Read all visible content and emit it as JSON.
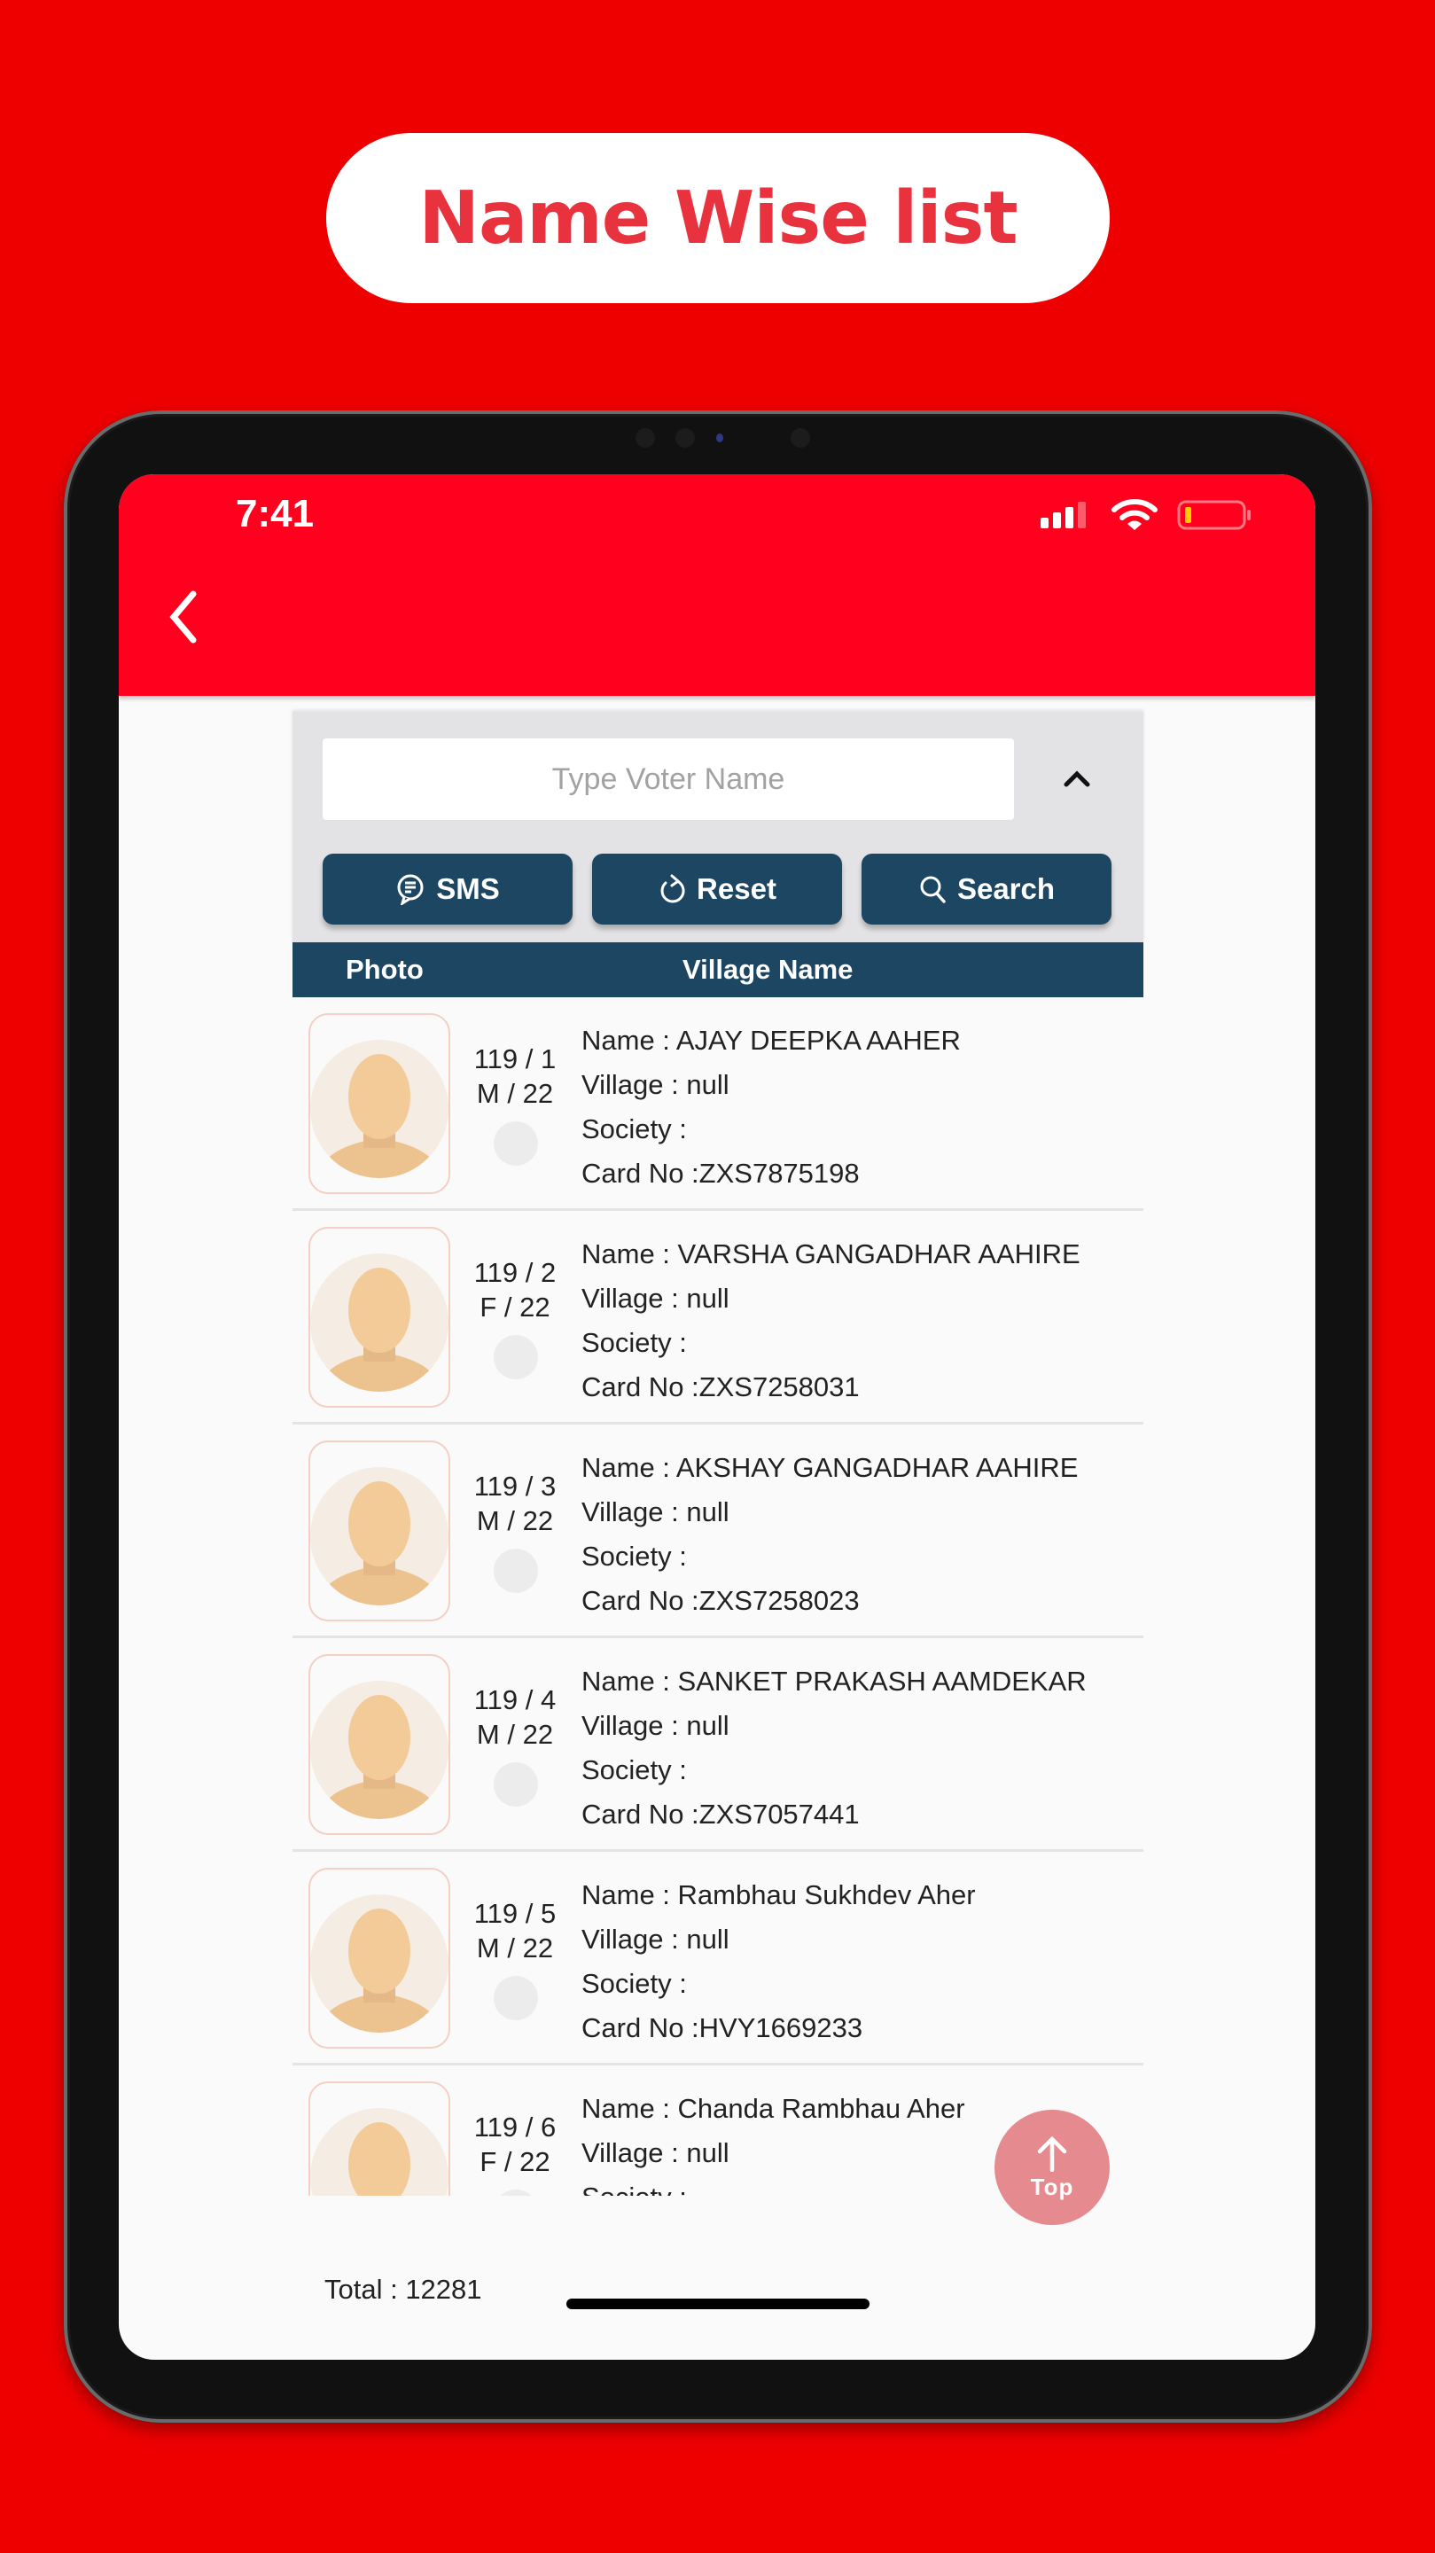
{
  "banner": {
    "title": "Name Wise list"
  },
  "status_bar": {
    "time": "7:41",
    "icons": [
      "signal-icon",
      "wifi-icon",
      "battery-low-icon"
    ]
  },
  "app_bar": {
    "back_icon": "chevron-left-icon"
  },
  "search": {
    "placeholder": "Type Voter Name",
    "value": "",
    "collapse_icon": "chevron-up-icon"
  },
  "buttons": {
    "sms": {
      "label": "SMS",
      "icon": "chat-icon"
    },
    "reset": {
      "label": "Reset",
      "icon": "refresh-icon"
    },
    "search": {
      "label": "Search",
      "icon": "search-icon"
    }
  },
  "table": {
    "headers": {
      "photo": "Photo",
      "village": "Village Name"
    },
    "rows": [
      {
        "serial": "119 / 1",
        "gender_age": "M / 22",
        "name": "Name : AJAY DEEPKA AAHER",
        "village": "Village : null",
        "society": "Society :",
        "card": "Card No :ZXS7875198"
      },
      {
        "serial": "119 / 2",
        "gender_age": "F / 22",
        "name": "Name : VARSHA GANGADHAR AAHIRE",
        "village": "Village : null",
        "society": "Society :",
        "card": "Card No :ZXS7258031"
      },
      {
        "serial": "119 / 3",
        "gender_age": "M / 22",
        "name": "Name : AKSHAY GANGADHAR AAHIRE",
        "village": "Village : null",
        "society": "Society :",
        "card": "Card No :ZXS7258023"
      },
      {
        "serial": "119 / 4",
        "gender_age": "M / 22",
        "name": "Name : SANKET PRAKASH AAMDEKAR",
        "village": "Village : null",
        "society": "Society :",
        "card": "Card No :ZXS7057441"
      },
      {
        "serial": "119 / 5",
        "gender_age": "M / 22",
        "name": "Name : Rambhau Sukhdev Aher",
        "village": "Village : null",
        "society": "Society :",
        "card": "Card No :HVY1669233"
      },
      {
        "serial": "119 / 6",
        "gender_age": "F / 22",
        "name": "Name : Chanda Rambhau Aher",
        "village": "Village : null",
        "society": "Society :",
        "card": ""
      }
    ]
  },
  "scroll_top": {
    "label": "Top",
    "icon": "arrow-up-icon"
  },
  "footer": {
    "total": "Total : 12281"
  },
  "colors": {
    "brand_red": "#ff001e",
    "navy": "#1d4663",
    "top_button": "#e58a8e",
    "banner_text": "#e8333f"
  }
}
